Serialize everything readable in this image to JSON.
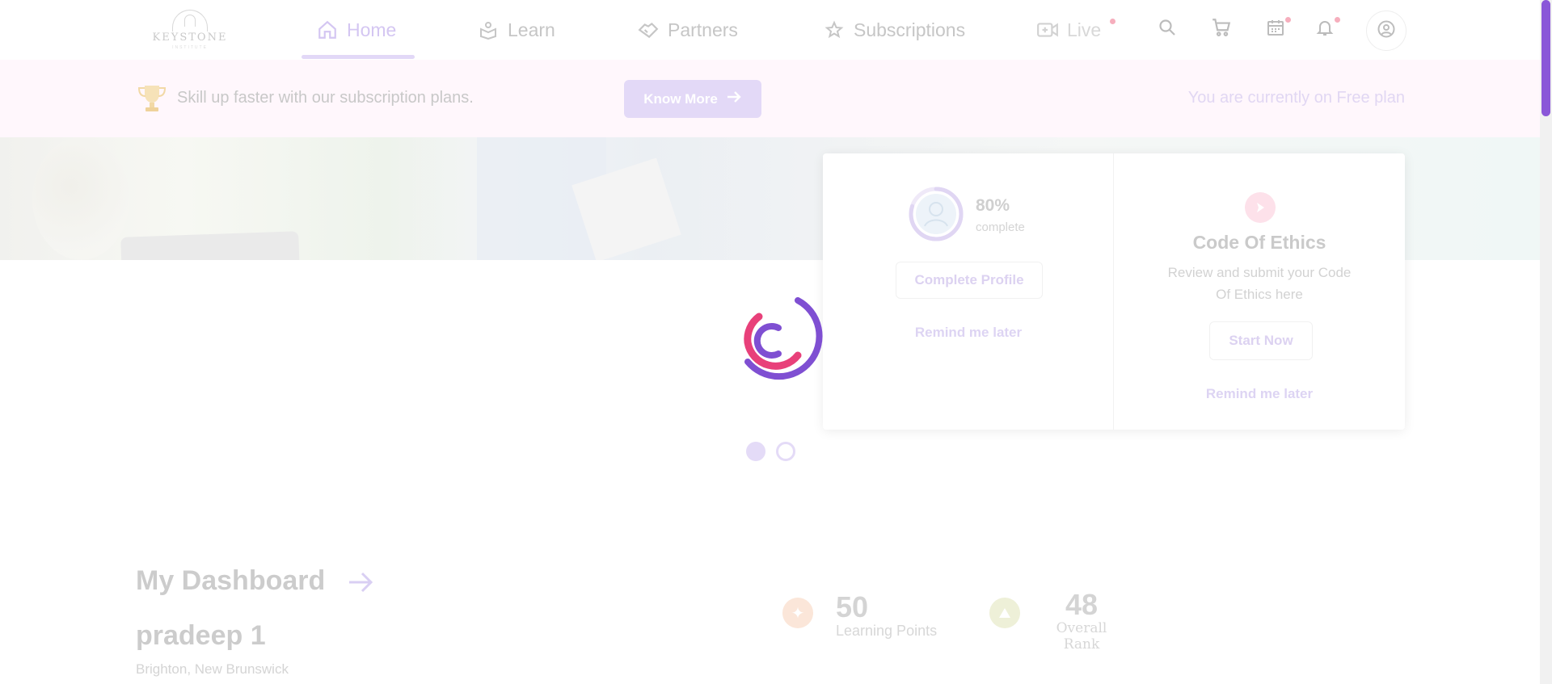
{
  "brand": {
    "logo_text": "KEYSTONE",
    "logo_sub": "INSTITUTE"
  },
  "nav": {
    "home": "Home",
    "learn": "Learn",
    "partners": "Partners",
    "subscriptions": "Subscriptions",
    "live": "Live"
  },
  "banner": {
    "message": "Skill up faster with our subscription plans.",
    "button": "Know More",
    "plan_status": "You are currently on Free plan"
  },
  "profile_card": {
    "percent": "80%",
    "percent_label": "complete",
    "progress_fraction": 0.8,
    "button": "Complete Profile",
    "remind": "Remind me later"
  },
  "ethics_card": {
    "title": "Code Of Ethics",
    "description": "Review and submit your Code Of Ethics here",
    "button": "Start Now",
    "remind": "Remind me later"
  },
  "dashboard": {
    "title": "My Dashboard",
    "user_name": "pradeep 1",
    "location": "Brighton, New Brunswick",
    "learning_points": "50",
    "learning_points_label": "Learning Points",
    "overall_rank": "48",
    "overall_rank_label": "Overall Rank"
  },
  "colors": {
    "accent": "#8a57d8",
    "spinner_pink": "#e8407a",
    "spinner_purple": "#7f4fd2"
  },
  "icons": [
    "home-icon",
    "learn-icon",
    "partners-icon",
    "star-icon",
    "video-icon",
    "search-icon",
    "cart-icon",
    "calendar-icon",
    "bell-icon",
    "user-icon",
    "trophy-icon",
    "arrow-right-icon",
    "play-icon"
  ]
}
